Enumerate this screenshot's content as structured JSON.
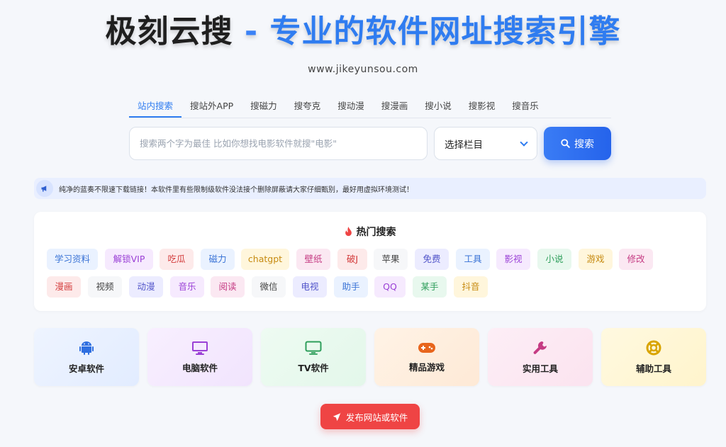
{
  "header": {
    "brand": "极刻云搜",
    "dash": " - ",
    "slogan": "专业的软件网址搜索引擎",
    "domain": "www.jikeyunsou.com"
  },
  "tabs": [
    "站内搜索",
    "搜站外APP",
    "搜磁力",
    "搜夸克",
    "搜动漫",
    "搜漫画",
    "搜小说",
    "搜影视",
    "搜音乐"
  ],
  "search": {
    "placeholder": "搜索两个字为最佳 比如你想找电影软件就搜\"电影\"",
    "select_label": "选择栏目",
    "button_label": "搜索"
  },
  "notice": {
    "text": "纯净的蓝奏不限速下载链接！本软件里有些限制级软件没法接个删除屏蔽请大家仔细甄别，最好用虚拟环境测试！"
  },
  "hot": {
    "title": "热门搜索",
    "tags": [
      "学习资料",
      "解锁VIP",
      "吃瓜",
      "磁力",
      "chatgpt",
      "壁纸",
      "破J",
      "苹果",
      "免费",
      "工具",
      "影视",
      "小说",
      "游戏",
      "修改",
      "漫画",
      "视频",
      "动漫",
      "音乐",
      "阅读",
      "微信",
      "电视",
      "助手",
      "QQ",
      "某手",
      "抖音"
    ]
  },
  "categories": [
    {
      "label": "安卓软件",
      "icon": "android-icon"
    },
    {
      "label": "电脑软件",
      "icon": "desktop-icon"
    },
    {
      "label": "TV软件",
      "icon": "tv-icon"
    },
    {
      "label": "精品游戏",
      "icon": "gamepad-icon"
    },
    {
      "label": "实用工具",
      "icon": "wrench-icon"
    },
    {
      "label": "辅助工具",
      "icon": "lifebuoy-icon"
    }
  ],
  "publish": {
    "label": "发布网站或软件"
  },
  "colors": {
    "accent": "#2f7cf0",
    "publish": "#ef4444"
  }
}
